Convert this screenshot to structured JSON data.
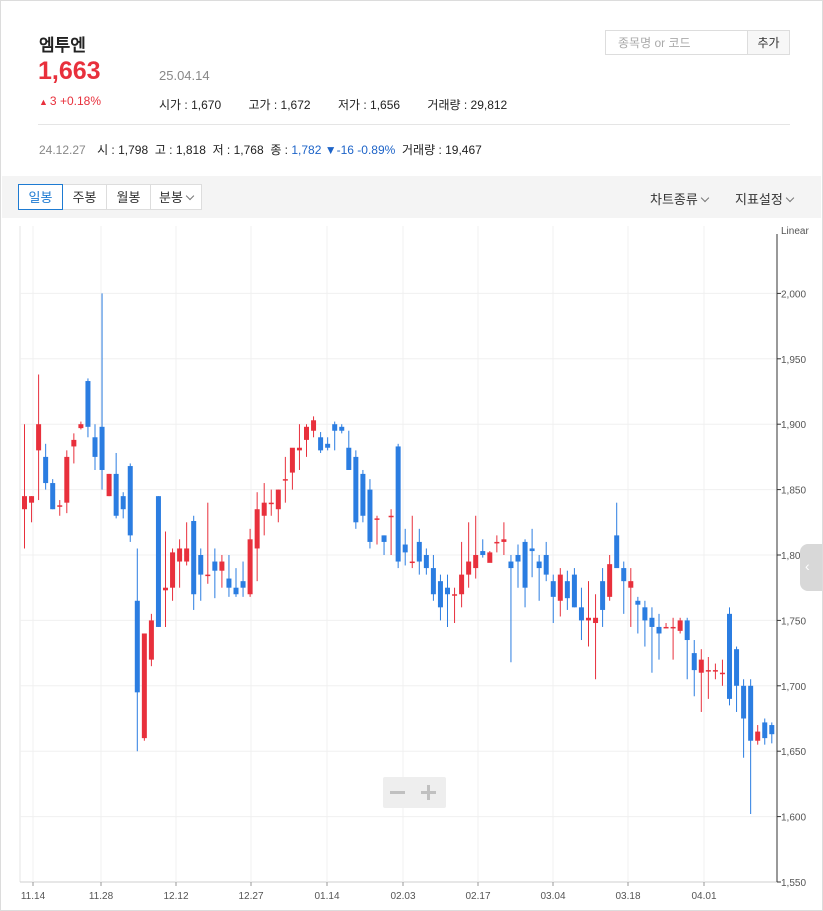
{
  "stock": {
    "name": "엠투엔",
    "price": "1,663",
    "change_arrow": "▲",
    "change_amount": "3",
    "change_percent": "+0.18%",
    "date": "25.04.14",
    "open": "시가 : 1,670",
    "high": "고가 : 1,672",
    "low": "저가 : 1,656",
    "volume": "거래량 : 29,812"
  },
  "search": {
    "placeholder": "종목명 or 코드",
    "add_label": "추가"
  },
  "hover": {
    "date": "24.12.27",
    "open": "시 : 1,798",
    "high": "고 : 1,818",
    "low": "저 : 1,768",
    "close_label": "종 : ",
    "close_value": "1,782",
    "change": "▼-16 -0.89%",
    "volume": "거래량 : 19,467"
  },
  "toolbar": {
    "tabs": [
      "일봉",
      "주봉",
      "월봉",
      "분봉"
    ],
    "chart_type": "차트종류",
    "indicator_settings": "지표설정"
  },
  "colors": {
    "up": "#e8303c",
    "down": "#2b7de1",
    "grid": "#f0f0f0",
    "accent": "#1e7bd2"
  },
  "chart_data": {
    "type": "candlestick",
    "scale_label": "Linear",
    "ylim": [
      1550,
      2050
    ],
    "y_ticks": [
      1550,
      1600,
      1650,
      1700,
      1750,
      1800,
      1850,
      1900,
      1950,
      2000
    ],
    "x_ticks": [
      "11.14",
      "11.28",
      "12.12",
      "12.27",
      "01.14",
      "02.03",
      "02.17",
      "03.04",
      "03.18",
      "04.01"
    ],
    "candles": [
      {
        "o": 1835,
        "h": 1900,
        "l": 1805,
        "c": 1845
      },
      {
        "o": 1840,
        "h": 1845,
        "l": 1825,
        "c": 1845
      },
      {
        "o": 1880,
        "h": 1938,
        "l": 1842,
        "c": 1900
      },
      {
        "o": 1875,
        "h": 1885,
        "l": 1850,
        "c": 1855
      },
      {
        "o": 1855,
        "h": 1858,
        "l": 1835,
        "c": 1835
      },
      {
        "o": 1838,
        "h": 1842,
        "l": 1830,
        "c": 1838
      },
      {
        "o": 1840,
        "h": 1880,
        "l": 1832,
        "c": 1875
      },
      {
        "o": 1883,
        "h": 1893,
        "l": 1870,
        "c": 1888
      },
      {
        "o": 1897,
        "h": 1902,
        "l": 1896,
        "c": 1900
      },
      {
        "o": 1933,
        "h": 1935,
        "l": 1890,
        "c": 1898
      },
      {
        "o": 1890,
        "h": 1900,
        "l": 1865,
        "c": 1875
      },
      {
        "o": 1898,
        "h": 2000,
        "l": 1850,
        "c": 1865
      },
      {
        "o": 1845,
        "h": 1862,
        "l": 1845,
        "c": 1862
      },
      {
        "o": 1862,
        "h": 1878,
        "l": 1828,
        "c": 1830
      },
      {
        "o": 1845,
        "h": 1848,
        "l": 1828,
        "c": 1835
      },
      {
        "o": 1868,
        "h": 1870,
        "l": 1810,
        "c": 1815
      },
      {
        "o": 1765,
        "h": 1805,
        "l": 1650,
        "c": 1695
      },
      {
        "o": 1660,
        "h": 1740,
        "l": 1658,
        "c": 1740
      },
      {
        "o": 1720,
        "h": 1755,
        "l": 1715,
        "c": 1750
      },
      {
        "o": 1845,
        "h": 1845,
        "l": 1745,
        "c": 1745
      },
      {
        "o": 1773,
        "h": 1818,
        "l": 1745,
        "c": 1775
      },
      {
        "o": 1775,
        "h": 1805,
        "l": 1765,
        "c": 1802
      },
      {
        "o": 1795,
        "h": 1812,
        "l": 1775,
        "c": 1805
      },
      {
        "o": 1795,
        "h": 1825,
        "l": 1792,
        "c": 1805
      },
      {
        "o": 1826,
        "h": 1830,
        "l": 1758,
        "c": 1770
      },
      {
        "o": 1800,
        "h": 1805,
        "l": 1765,
        "c": 1785
      },
      {
        "o": 1785,
        "h": 1840,
        "l": 1778,
        "c": 1785
      },
      {
        "o": 1795,
        "h": 1805,
        "l": 1767,
        "c": 1788
      },
      {
        "o": 1788,
        "h": 1800,
        "l": 1775,
        "c": 1795
      },
      {
        "o": 1782,
        "h": 1800,
        "l": 1768,
        "c": 1775
      },
      {
        "o": 1775,
        "h": 1790,
        "l": 1768,
        "c": 1770
      },
      {
        "o": 1780,
        "h": 1795,
        "l": 1768,
        "c": 1775
      },
      {
        "o": 1770,
        "h": 1820,
        "l": 1768,
        "c": 1812
      },
      {
        "o": 1805,
        "h": 1848,
        "l": 1780,
        "c": 1835
      },
      {
        "o": 1830,
        "h": 1855,
        "l": 1815,
        "c": 1840
      },
      {
        "o": 1840,
        "h": 1850,
        "l": 1830,
        "c": 1840
      },
      {
        "o": 1835,
        "h": 1850,
        "l": 1825,
        "c": 1850
      },
      {
        "o": 1857,
        "h": 1875,
        "l": 1840,
        "c": 1858
      },
      {
        "o": 1863,
        "h": 1873,
        "l": 1850,
        "c": 1882
      },
      {
        "o": 1880,
        "h": 1900,
        "l": 1865,
        "c": 1882
      },
      {
        "o": 1888,
        "h": 1900,
        "l": 1875,
        "c": 1898
      },
      {
        "o": 1895,
        "h": 1906,
        "l": 1890,
        "c": 1903
      },
      {
        "o": 1890,
        "h": 1894,
        "l": 1878,
        "c": 1880
      },
      {
        "o": 1885,
        "h": 1890,
        "l": 1880,
        "c": 1882
      },
      {
        "o": 1900,
        "h": 1902,
        "l": 1880,
        "c": 1895
      },
      {
        "o": 1898,
        "h": 1900,
        "l": 1893,
        "c": 1895
      },
      {
        "o": 1882,
        "h": 1895,
        "l": 1865,
        "c": 1865
      },
      {
        "o": 1875,
        "h": 1880,
        "l": 1820,
        "c": 1825
      },
      {
        "o": 1862,
        "h": 1865,
        "l": 1825,
        "c": 1830
      },
      {
        "o": 1850,
        "h": 1858,
        "l": 1805,
        "c": 1810
      },
      {
        "o": 1828,
        "h": 1830,
        "l": 1808,
        "c": 1828
      },
      {
        "o": 1815,
        "h": 1815,
        "l": 1800,
        "c": 1810
      },
      {
        "o": 1830,
        "h": 1835,
        "l": 1800,
        "c": 1830
      },
      {
        "o": 1883,
        "h": 1885,
        "l": 1790,
        "c": 1795
      },
      {
        "o": 1808,
        "h": 1820,
        "l": 1792,
        "c": 1802
      },
      {
        "o": 1795,
        "h": 1830,
        "l": 1790,
        "c": 1795
      },
      {
        "o": 1810,
        "h": 1820,
        "l": 1785,
        "c": 1795
      },
      {
        "o": 1800,
        "h": 1805,
        "l": 1785,
        "c": 1790
      },
      {
        "o": 1790,
        "h": 1800,
        "l": 1765,
        "c": 1770
      },
      {
        "o": 1780,
        "h": 1785,
        "l": 1750,
        "c": 1760
      },
      {
        "o": 1775,
        "h": 1785,
        "l": 1745,
        "c": 1770
      },
      {
        "o": 1770,
        "h": 1775,
        "l": 1748,
        "c": 1770
      },
      {
        "o": 1770,
        "h": 1810,
        "l": 1760,
        "c": 1785
      },
      {
        "o": 1785,
        "h": 1825,
        "l": 1775,
        "c": 1795
      },
      {
        "o": 1790,
        "h": 1830,
        "l": 1782,
        "c": 1800
      },
      {
        "o": 1803,
        "h": 1812,
        "l": 1798,
        "c": 1800
      },
      {
        "o": 1794,
        "h": 1803,
        "l": 1795,
        "c": 1802
      },
      {
        "o": 1810,
        "h": 1815,
        "l": 1802,
        "c": 1810
      },
      {
        "o": 1810,
        "h": 1825,
        "l": 1800,
        "c": 1812
      },
      {
        "o": 1795,
        "h": 1800,
        "l": 1718,
        "c": 1790
      },
      {
        "o": 1800,
        "h": 1808,
        "l": 1775,
        "c": 1795
      },
      {
        "o": 1810,
        "h": 1812,
        "l": 1760,
        "c": 1775
      },
      {
        "o": 1805,
        "h": 1820,
        "l": 1783,
        "c": 1803
      },
      {
        "o": 1795,
        "h": 1800,
        "l": 1765,
        "c": 1790
      },
      {
        "o": 1800,
        "h": 1810,
        "l": 1780,
        "c": 1785
      },
      {
        "o": 1780,
        "h": 1785,
        "l": 1748,
        "c": 1768
      },
      {
        "o": 1765,
        "h": 1790,
        "l": 1753,
        "c": 1785
      },
      {
        "o": 1780,
        "h": 1788,
        "l": 1758,
        "c": 1767
      },
      {
        "o": 1785,
        "h": 1790,
        "l": 1760,
        "c": 1760
      },
      {
        "o": 1760,
        "h": 1775,
        "l": 1735,
        "c": 1750
      },
      {
        "o": 1750,
        "h": 1780,
        "l": 1730,
        "c": 1752
      },
      {
        "o": 1748,
        "h": 1770,
        "l": 1705,
        "c": 1752
      },
      {
        "o": 1780,
        "h": 1790,
        "l": 1745,
        "c": 1758
      },
      {
        "o": 1768,
        "h": 1800,
        "l": 1765,
        "c": 1793
      },
      {
        "o": 1815,
        "h": 1840,
        "l": 1795,
        "c": 1790
      },
      {
        "o": 1790,
        "h": 1795,
        "l": 1755,
        "c": 1780
      },
      {
        "o": 1775,
        "h": 1790,
        "l": 1745,
        "c": 1780
      },
      {
        "o": 1765,
        "h": 1768,
        "l": 1740,
        "c": 1762
      },
      {
        "o": 1760,
        "h": 1765,
        "l": 1730,
        "c": 1750
      },
      {
        "o": 1752,
        "h": 1760,
        "l": 1710,
        "c": 1745
      },
      {
        "o": 1745,
        "h": 1755,
        "l": 1720,
        "c": 1740
      },
      {
        "o": 1745,
        "h": 1748,
        "l": 1745,
        "c": 1745
      },
      {
        "o": 1745,
        "h": 1752,
        "l": 1720,
        "c": 1745
      },
      {
        "o": 1742,
        "h": 1752,
        "l": 1740,
        "c": 1750
      },
      {
        "o": 1750,
        "h": 1752,
        "l": 1705,
        "c": 1735
      },
      {
        "o": 1725,
        "h": 1735,
        "l": 1692,
        "c": 1712
      },
      {
        "o": 1710,
        "h": 1728,
        "l": 1680,
        "c": 1720
      },
      {
        "o": 1712,
        "h": 1722,
        "l": 1690,
        "c": 1712
      },
      {
        "o": 1712,
        "h": 1717,
        "l": 1705,
        "c": 1712
      },
      {
        "o": 1710,
        "h": 1720,
        "l": 1700,
        "c": 1710
      },
      {
        "o": 1755,
        "h": 1760,
        "l": 1685,
        "c": 1690
      },
      {
        "o": 1728,
        "h": 1730,
        "l": 1680,
        "c": 1700
      },
      {
        "o": 1700,
        "h": 1705,
        "l": 1645,
        "c": 1675
      },
      {
        "o": 1700,
        "h": 1705,
        "l": 1602,
        "c": 1658
      },
      {
        "o": 1658,
        "h": 1670,
        "l": 1655,
        "c": 1665
      },
      {
        "o": 1672,
        "h": 1675,
        "l": 1655,
        "c": 1660
      },
      {
        "o": 1670,
        "h": 1672,
        "l": 1656,
        "c": 1663
      }
    ]
  }
}
